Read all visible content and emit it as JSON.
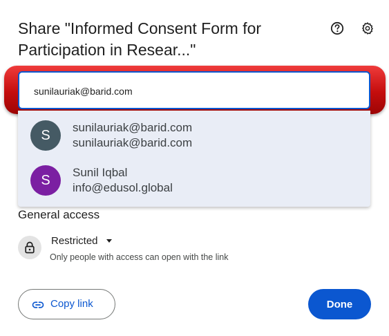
{
  "dialog": {
    "title": "Share \"Informed Consent Form for Participation in Resear...\""
  },
  "header_icons": [
    "help-icon",
    "gear-icon"
  ],
  "input": {
    "value": "sunilauriak@barid.com"
  },
  "suggestions": [
    {
      "avatar_letter": "S",
      "name": "sunilauriak@barid.com",
      "email": "sunilauriak@barid.com",
      "avatar_color": "#455a64"
    },
    {
      "avatar_letter": "S",
      "name": "Sunil Iqbal",
      "email": "info@edusol.global",
      "avatar_color": "#7b1fa2"
    }
  ],
  "general_access": {
    "heading": "General access",
    "level": "Restricted",
    "description": "Only people with access can open with the link"
  },
  "footer": {
    "copy_link_label": "Copy link",
    "done_label": "Done"
  },
  "colors": {
    "accent": "#0b57d0",
    "highlight": "#c40d0d"
  }
}
